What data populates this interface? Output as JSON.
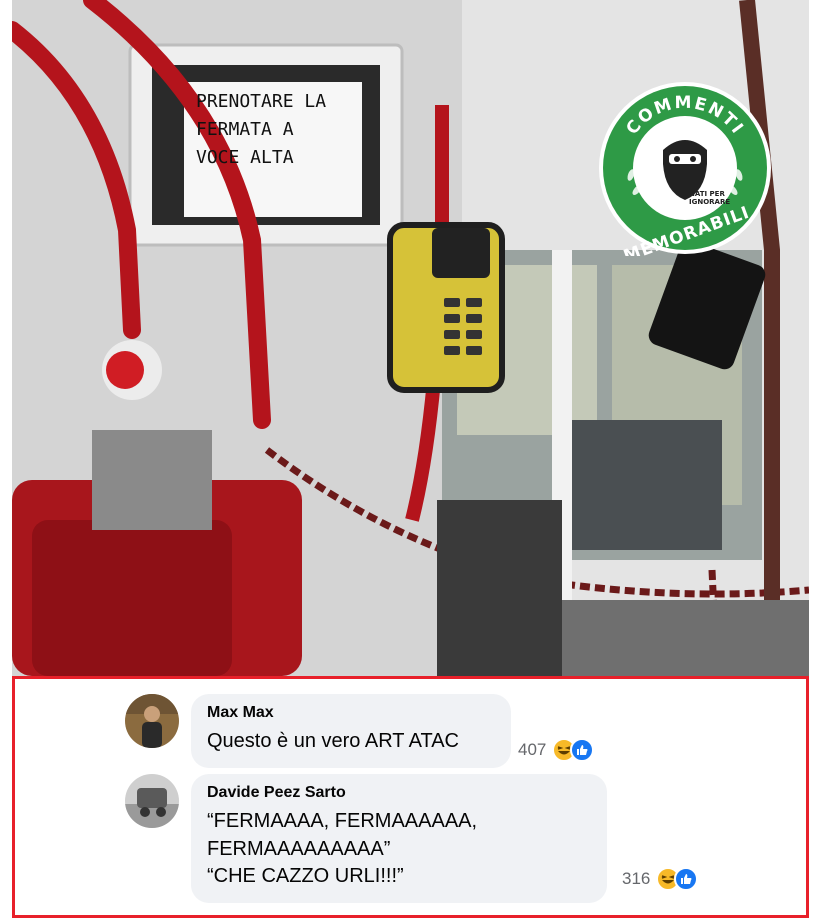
{
  "photo": {
    "sign_lines": [
      "PRENOTARE LA",
      "FERMATA A",
      "VOCE ALTA"
    ],
    "logo": {
      "top_text": "COMMENTI",
      "bottom_text": "MEMORABILI",
      "small_text_line1": "NATI PER",
      "small_text_line2": "IGNORARE",
      "colors": {
        "ring": "#2e9a46",
        "inner": "#ffffff",
        "dark": "#222222"
      }
    }
  },
  "comments": [
    {
      "author": "Max Max",
      "text_lines": [
        "Questo è un vero ART ATAC"
      ],
      "reaction_count": "407",
      "reactions": [
        "laugh-icon",
        "like-icon"
      ]
    },
    {
      "author": "Davide Peez Sarto",
      "text_lines": [
        "“FERMAAAA, FERMAAAAAA,",
        "FERMAAAAAAAAA”",
        "“CHE CAZZO URLI!!!”"
      ],
      "reaction_count": "316",
      "reactions": [
        "laugh-icon",
        "like-icon"
      ]
    }
  ],
  "colors": {
    "highlight_border": "#e8202a",
    "bubble": "#f0f2f5",
    "like_blue": "#1877f2",
    "laugh_yellow": "#f7b928"
  }
}
